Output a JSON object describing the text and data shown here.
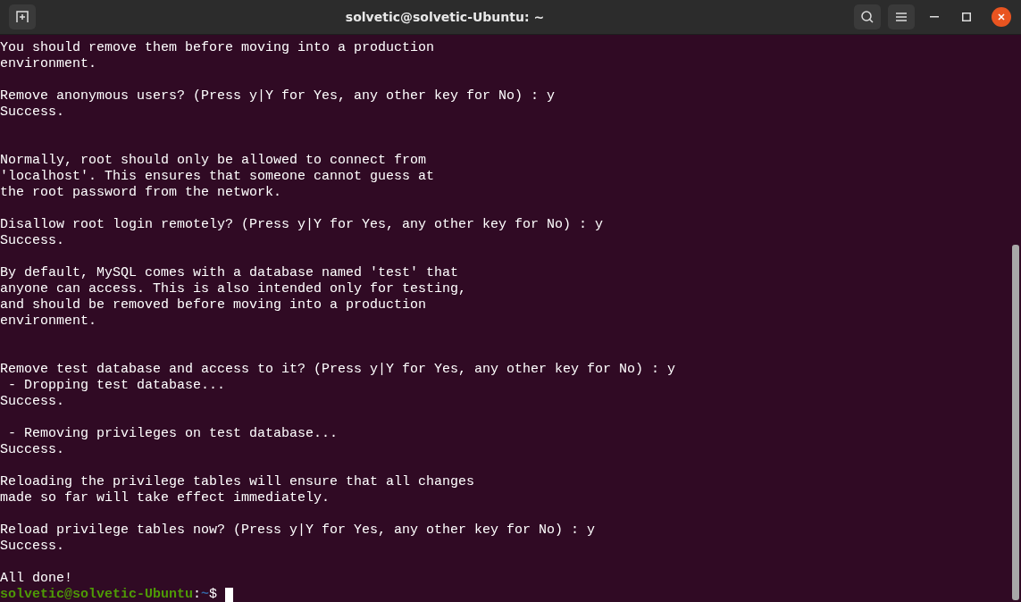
{
  "window": {
    "title": "solvetic@solvetic-Ubuntu: ~"
  },
  "terminal": {
    "lines": [
      {
        "kind": "text",
        "text": "You should remove them before moving into a production"
      },
      {
        "kind": "text",
        "text": "environment."
      },
      {
        "kind": "blank"
      },
      {
        "kind": "text",
        "text": "Remove anonymous users? (Press y|Y for Yes, any other key for No) : y"
      },
      {
        "kind": "text",
        "text": "Success."
      },
      {
        "kind": "blank"
      },
      {
        "kind": "blank"
      },
      {
        "kind": "text",
        "text": "Normally, root should only be allowed to connect from"
      },
      {
        "kind": "text",
        "text": "'localhost'. This ensures that someone cannot guess at"
      },
      {
        "kind": "text",
        "text": "the root password from the network."
      },
      {
        "kind": "blank"
      },
      {
        "kind": "text",
        "text": "Disallow root login remotely? (Press y|Y for Yes, any other key for No) : y"
      },
      {
        "kind": "text",
        "text": "Success."
      },
      {
        "kind": "blank"
      },
      {
        "kind": "text",
        "text": "By default, MySQL comes with a database named 'test' that"
      },
      {
        "kind": "text",
        "text": "anyone can access. This is also intended only for testing,"
      },
      {
        "kind": "text",
        "text": "and should be removed before moving into a production"
      },
      {
        "kind": "text",
        "text": "environment."
      },
      {
        "kind": "blank"
      },
      {
        "kind": "blank"
      },
      {
        "kind": "text",
        "text": "Remove test database and access to it? (Press y|Y for Yes, any other key for No) : y"
      },
      {
        "kind": "text",
        "text": " - Dropping test database..."
      },
      {
        "kind": "text",
        "text": "Success."
      },
      {
        "kind": "blank"
      },
      {
        "kind": "text",
        "text": " - Removing privileges on test database..."
      },
      {
        "kind": "text",
        "text": "Success."
      },
      {
        "kind": "blank"
      },
      {
        "kind": "text",
        "text": "Reloading the privilege tables will ensure that all changes"
      },
      {
        "kind": "text",
        "text": "made so far will take effect immediately."
      },
      {
        "kind": "blank"
      },
      {
        "kind": "text",
        "text": "Reload privilege tables now? (Press y|Y for Yes, any other key for No) : y"
      },
      {
        "kind": "text",
        "text": "Success."
      },
      {
        "kind": "blank"
      },
      {
        "kind": "text",
        "text": "All done!"
      }
    ],
    "prompt": {
      "user_host": "solvetic@solvetic-Ubuntu",
      "separator": ":",
      "path": "~",
      "symbol": "$"
    }
  }
}
